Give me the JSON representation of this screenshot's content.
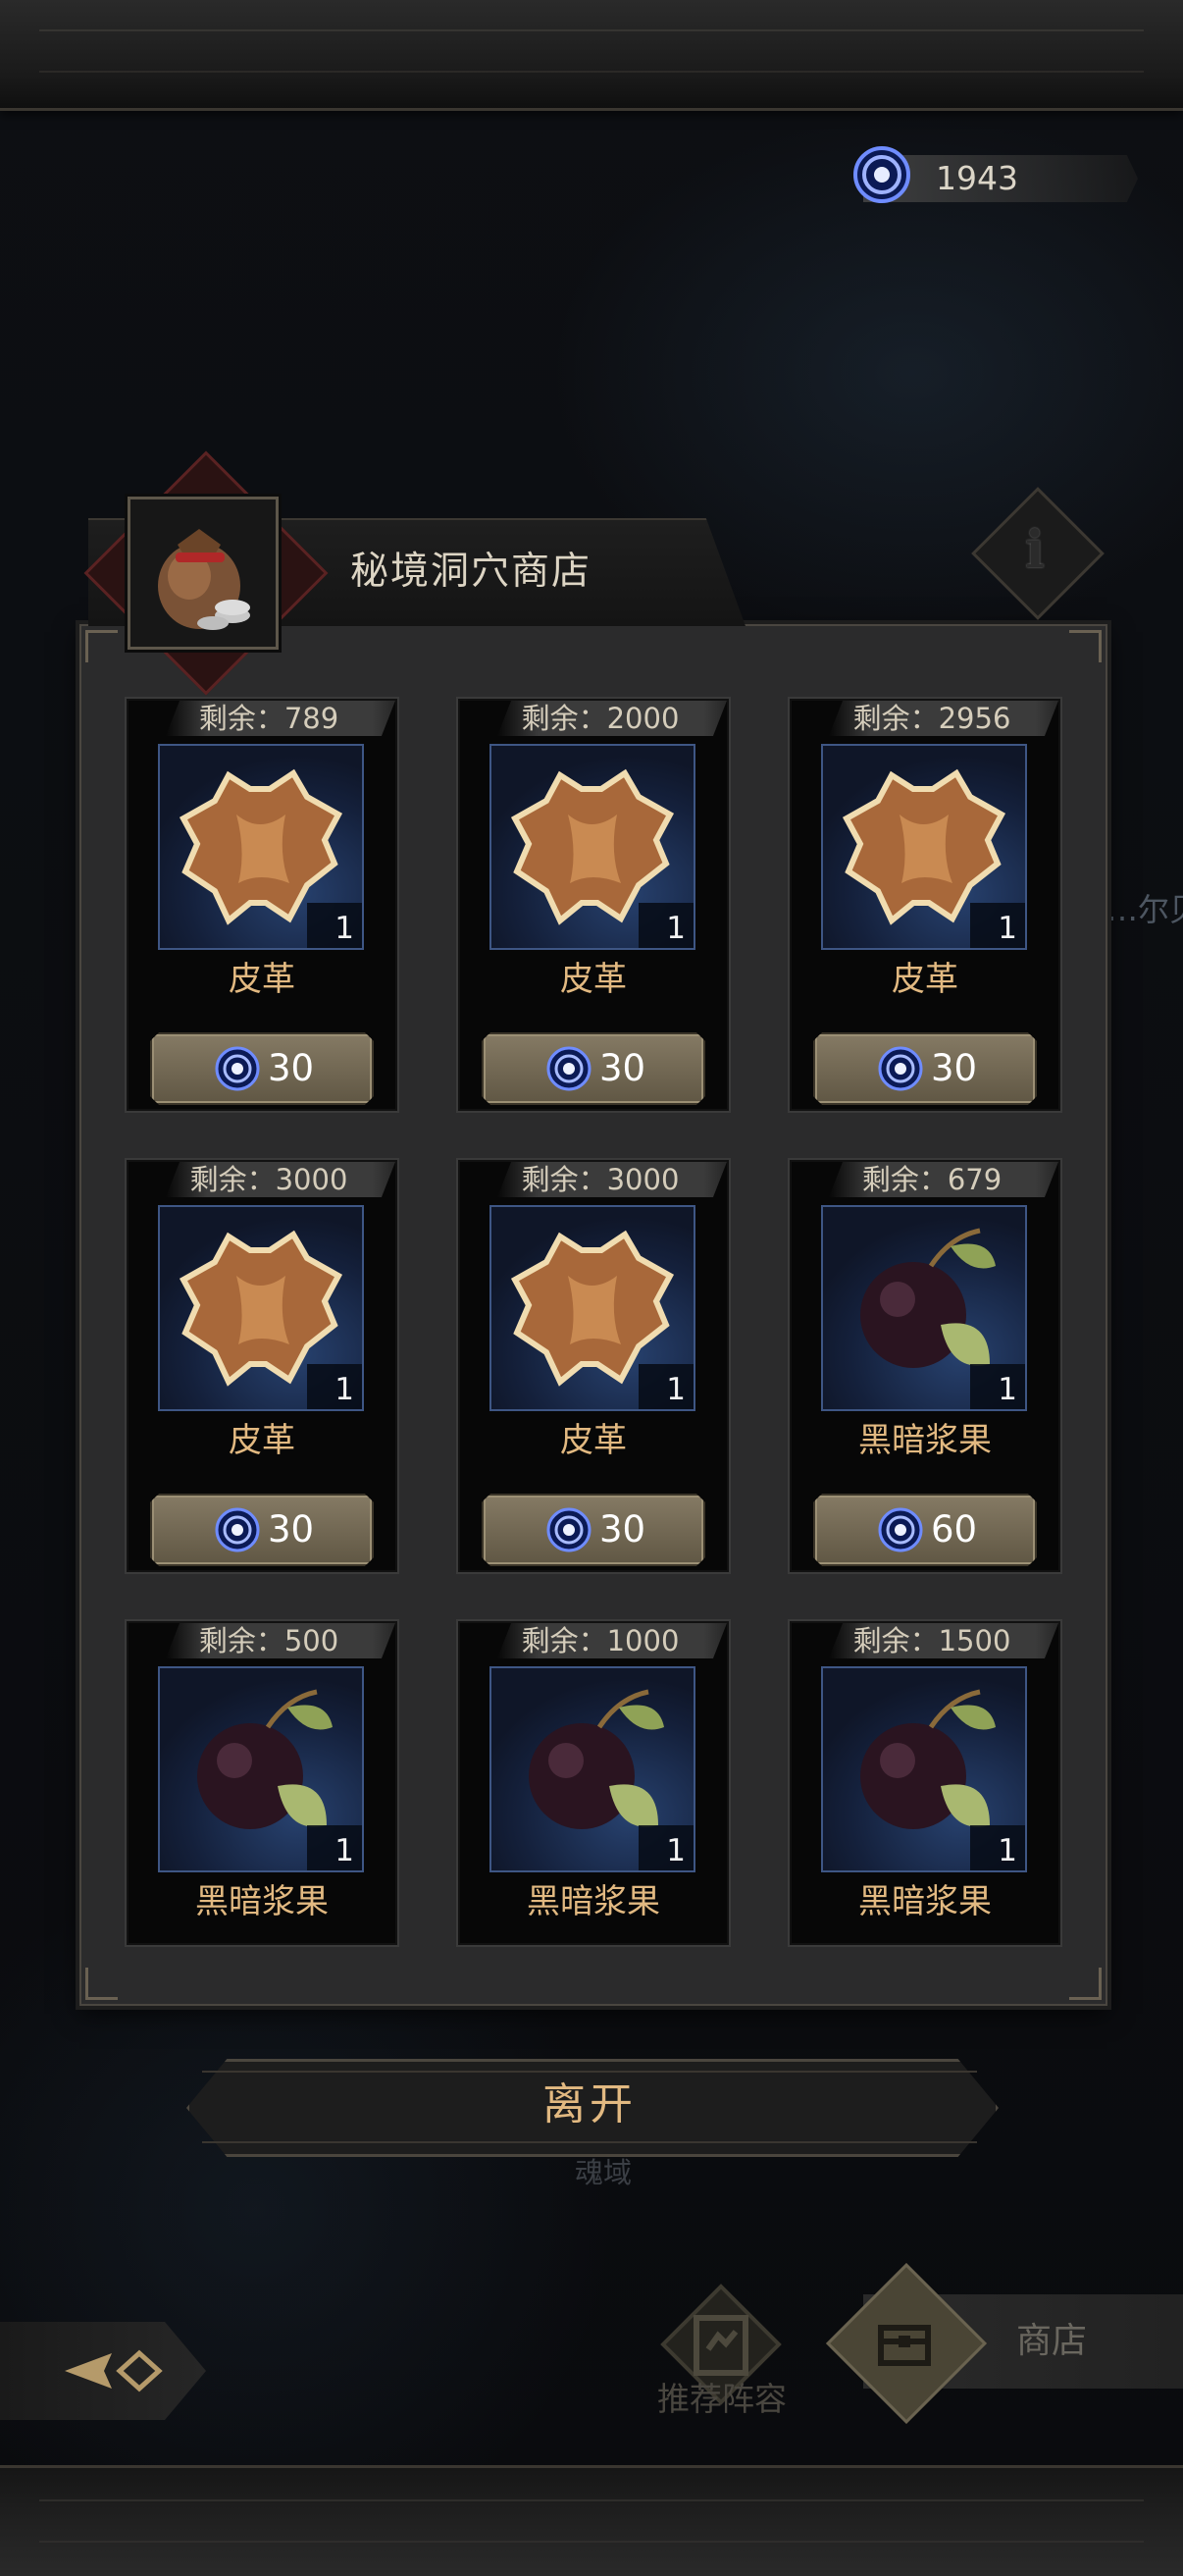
{
  "currency": {
    "amount": "1943",
    "icon": "soul-gem-icon",
    "color": "#3d63ff"
  },
  "shop": {
    "title": "秘境洞穴商店",
    "icon": "coin-bag-icon"
  },
  "items": [
    {
      "remaining": "剩余：789",
      "name": "皮革",
      "qty": "1",
      "price": "30",
      "kind": "leather"
    },
    {
      "remaining": "剩余：2000",
      "name": "皮革",
      "qty": "1",
      "price": "30",
      "kind": "leather"
    },
    {
      "remaining": "剩余：2956",
      "name": "皮革",
      "qty": "1",
      "price": "30",
      "kind": "leather"
    },
    {
      "remaining": "剩余：3000",
      "name": "皮革",
      "qty": "1",
      "price": "30",
      "kind": "leather"
    },
    {
      "remaining": "剩余：3000",
      "name": "皮革",
      "qty": "1",
      "price": "30",
      "kind": "leather"
    },
    {
      "remaining": "剩余：679",
      "name": "黑暗浆果",
      "qty": "1",
      "price": "60",
      "kind": "berry"
    },
    {
      "remaining": "剩余：500",
      "name": "黑暗浆果",
      "qty": "1",
      "price": "",
      "kind": "berry"
    },
    {
      "remaining": "剩余：1000",
      "name": "黑暗浆果",
      "qty": "1",
      "price": "",
      "kind": "berry"
    },
    {
      "remaining": "剩余：1500",
      "name": "黑暗浆果",
      "qty": "1",
      "price": "",
      "kind": "berry"
    }
  ],
  "leave_label": "离开",
  "background_text": {
    "zone": "魂域",
    "side": "…尔贝"
  },
  "nav": {
    "recommend_label": "推荐阵容",
    "shop_label": "商店"
  },
  "colors": {
    "accent_gold": "#e2b981",
    "slot_blue": "#1c2f55"
  }
}
